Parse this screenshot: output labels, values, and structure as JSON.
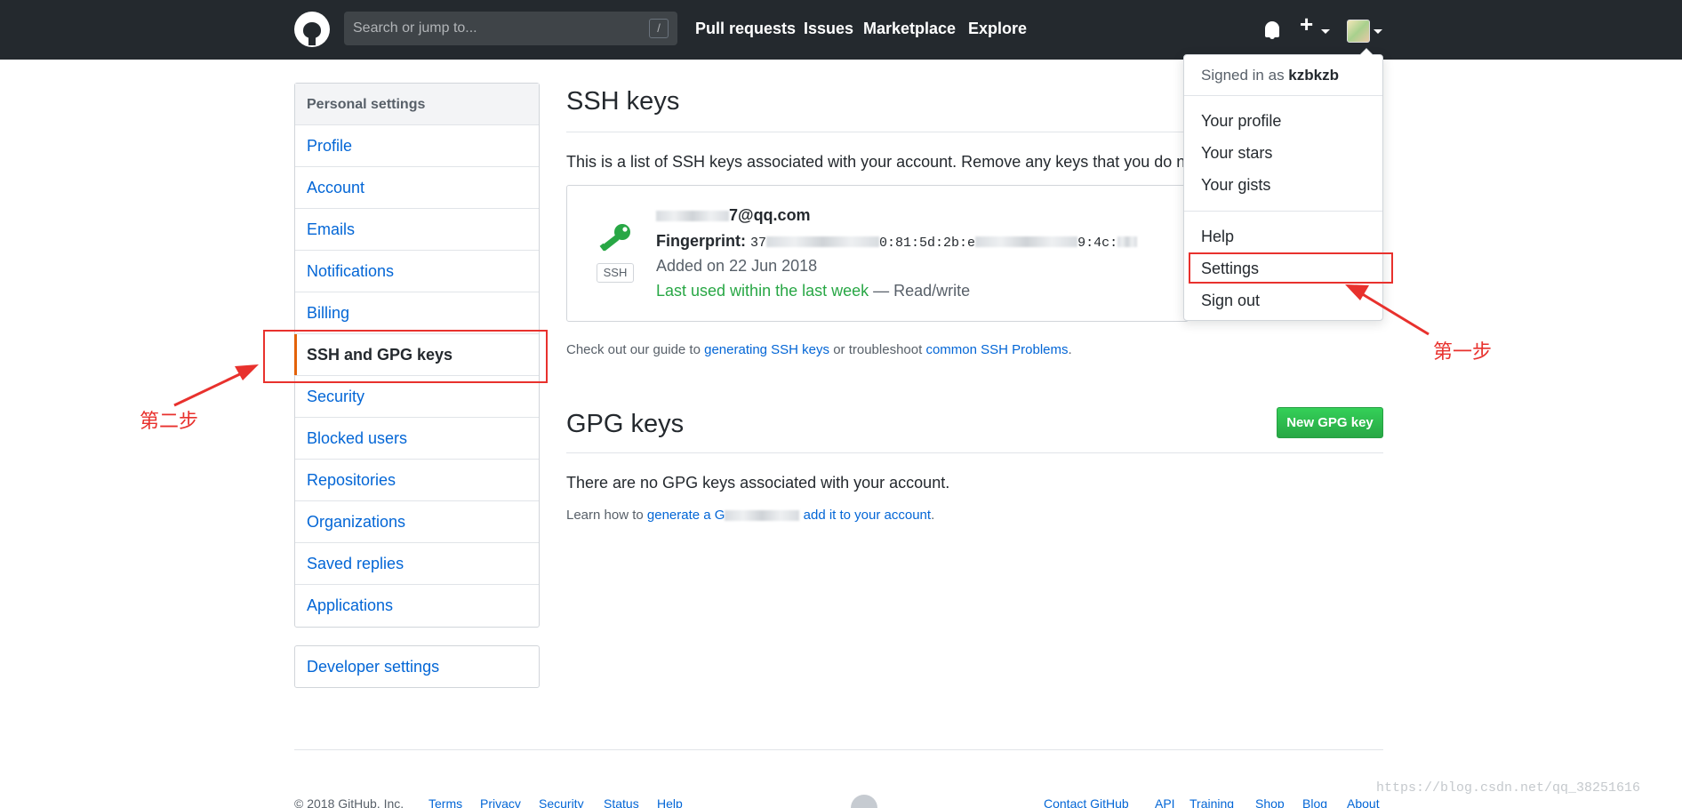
{
  "header": {
    "search_placeholder": "Search or jump to...",
    "search_shortcut": "/",
    "nav": [
      "Pull requests",
      "Issues",
      "Marketplace",
      "Explore"
    ],
    "plus": "+"
  },
  "sidebar": {
    "heading": "Personal settings",
    "items": [
      "Profile",
      "Account",
      "Emails",
      "Notifications",
      "Billing",
      "SSH and GPG keys",
      "Security",
      "Blocked users",
      "Repositories",
      "Organizations",
      "Saved replies",
      "Applications"
    ],
    "selected": "SSH and GPG keys",
    "developer": "Developer settings"
  },
  "ssh": {
    "title": "SSH keys",
    "intro": "This is a list of SSH keys associated with your account. Remove any keys that you do not re",
    "key": {
      "email_suffix": "7@qq.com",
      "fingerprint_label": "Fingerprint:",
      "fingerprint_start": "37",
      "fingerprint_mid": "0:81:5d:2b:e",
      "fingerprint_end": "9:4c:",
      "added": "Added on 22 Jun 2018",
      "last_used": "Last used within the last week",
      "access": " — Read/write",
      "badge": "SSH"
    },
    "help": {
      "prefix": "Check out our guide to ",
      "link1": "generating SSH keys",
      "middle": " or troubleshoot ",
      "link2": "common SSH Problems",
      "suffix": "."
    }
  },
  "gpg": {
    "title": "GPG keys",
    "new_button": "New GPG key",
    "empty": "There are no GPG keys associated with your account.",
    "learn_prefix": "Learn how to ",
    "learn_link1": "generate a G",
    "learn_link2": "add it to your account",
    "learn_suffix": "."
  },
  "dropdown": {
    "signed_prefix": "Signed in as ",
    "username": "kzbkzb",
    "items": [
      "Your profile",
      "Your stars",
      "Your gists",
      "Help",
      "Settings",
      "Sign out"
    ]
  },
  "annotations": {
    "step1": "第一步",
    "step2": "第二步"
  },
  "footer": {
    "copyright": "© 2018 GitHub, Inc.",
    "left_links": [
      "Terms",
      "Privacy",
      "Security",
      "Status",
      "Help"
    ],
    "right_links": [
      "Contact GitHub",
      "API",
      "Training",
      "Shop",
      "Blog",
      "About"
    ]
  },
  "watermark": "https://blog.csdn.net/qq_38251616",
  "colors": {
    "header_bg": "#24292e",
    "link": "#0366d6",
    "green": "#28a745",
    "selected_border": "#e36209",
    "annotation_red": "#e8312d"
  }
}
